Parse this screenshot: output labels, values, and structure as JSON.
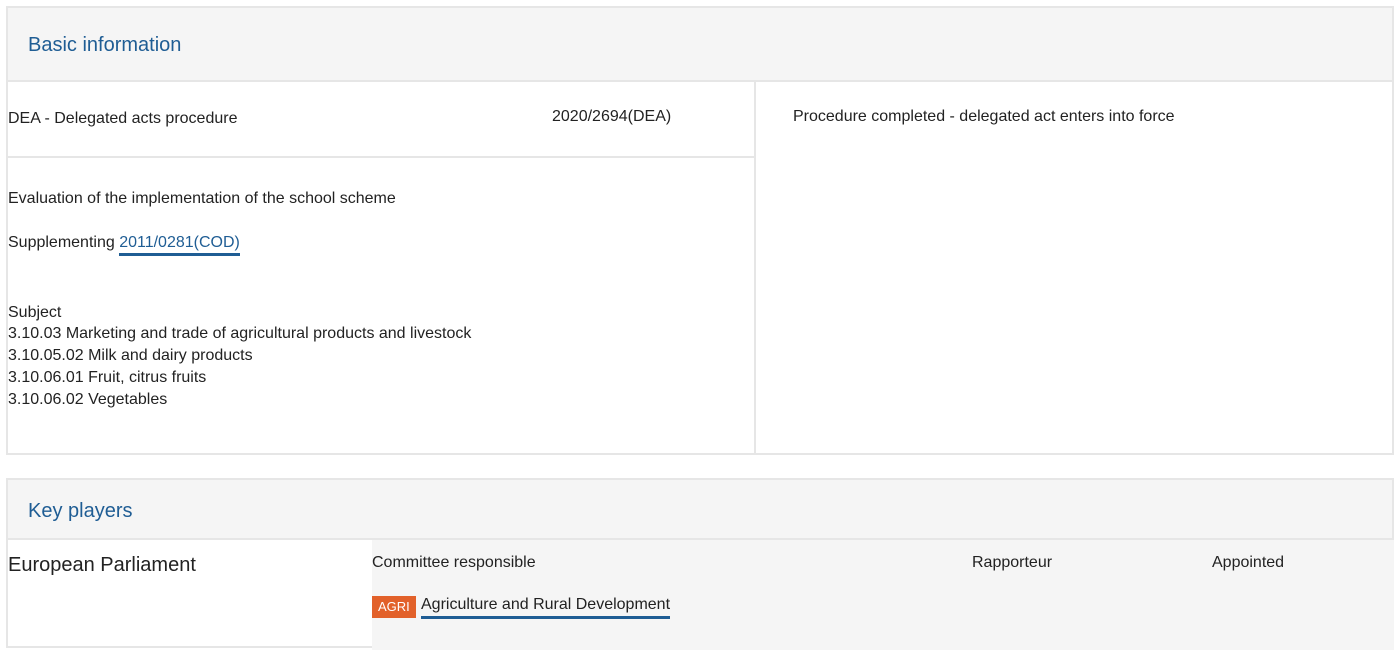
{
  "basic_info": {
    "title": "Basic information",
    "procedure_type": "DEA - Delegated acts procedure",
    "procedure_ref": "2020/2694(DEA)",
    "status": "Procedure completed - delegated act enters into force",
    "description": "Evaluation of the implementation of the school scheme",
    "supplementing_label": "Supplementing",
    "supplementing_ref": "2011/0281(COD)",
    "subject_label": "Subject",
    "subjects": [
      "3.10.03 Marketing and trade of agricultural products and livestock",
      "3.10.05.02 Milk and dairy products",
      "3.10.06.01 Fruit, citrus fruits",
      "3.10.06.02 Vegetables"
    ]
  },
  "key_players": {
    "title": "Key players",
    "institution": "European Parliament",
    "columns": {
      "committee": "Committee responsible",
      "rapporteur": "Rapporteur",
      "appointed": "Appointed"
    },
    "committee_badge": "AGRI",
    "committee_name": "Agriculture and Rural Development"
  },
  "colors": {
    "link": "#1f5d94",
    "badge": "#e2612a",
    "header_bg": "#f5f5f5",
    "border": "#e6e6e6"
  }
}
